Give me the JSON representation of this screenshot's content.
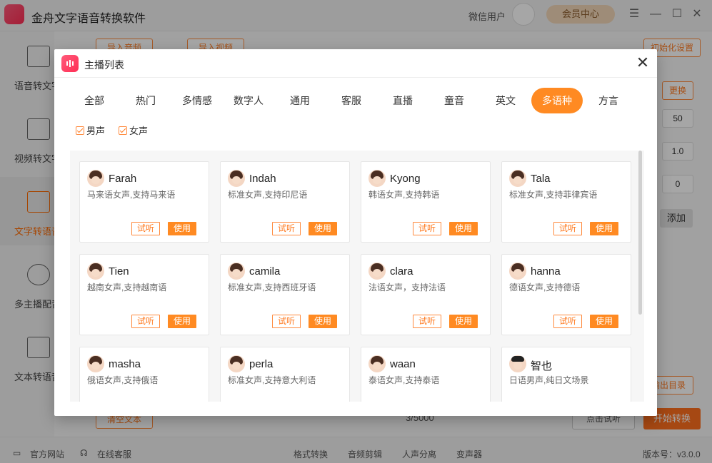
{
  "app": {
    "title": "金舟文字语音转换软件",
    "user_name": "微信用户",
    "vip_label": "会员中心"
  },
  "sidebar": {
    "items": [
      {
        "label": "语音转文字"
      },
      {
        "label": "视频转文字"
      },
      {
        "label": "文字转语音"
      },
      {
        "label": "多主播配音"
      },
      {
        "label": "文本转语音"
      }
    ]
  },
  "background": {
    "top_buttons": [
      "导入音频",
      "导入视频",
      "初始化设置"
    ],
    "change_label": "更换",
    "fields": [
      "50",
      "1.0",
      "0"
    ],
    "add_label": "添加",
    "clear_label": "清空文本",
    "char_count": "3/5000",
    "preview_label": "点击试听",
    "start_label": "开始转换",
    "output_label": "输出目录"
  },
  "status": {
    "website": "官方网站",
    "service": "在线客服",
    "tools": [
      "格式转换",
      "音频剪辑",
      "人声分离",
      "变声器"
    ],
    "version": "版本号：v3.0.0"
  },
  "modal": {
    "title": "主播列表",
    "tabs": [
      "全部",
      "热门",
      "多情感",
      "数字人",
      "通用",
      "客服",
      "直播",
      "童音",
      "英文",
      "多语种",
      "方言"
    ],
    "active_tab": "多语种",
    "filters": [
      "男声",
      "女声"
    ],
    "listen_label": "试听",
    "use_label": "使用",
    "voices": [
      {
        "name": "Farah",
        "desc": "马来语女声,支持马来语",
        "gender": "female"
      },
      {
        "name": "Indah",
        "desc": "标准女声,支持印尼语",
        "gender": "female"
      },
      {
        "name": "Kyong",
        "desc": "韩语女声,支持韩语",
        "gender": "female"
      },
      {
        "name": "Tala",
        "desc": "标准女声,支持菲律宾语",
        "gender": "female"
      },
      {
        "name": "Tien",
        "desc": "越南女声,支持越南语",
        "gender": "female"
      },
      {
        "name": "camila",
        "desc": "标准女声,支持西班牙语",
        "gender": "female"
      },
      {
        "name": "clara",
        "desc": "法语女声，支持法语",
        "gender": "female"
      },
      {
        "name": "hanna",
        "desc": "德语女声,支持德语",
        "gender": "female"
      },
      {
        "name": "masha",
        "desc": "俄语女声,支持俄语",
        "gender": "female"
      },
      {
        "name": "perla",
        "desc": "标准女声,支持意大利语",
        "gender": "female"
      },
      {
        "name": "waan",
        "desc": "泰语女声,支持泰语",
        "gender": "female"
      },
      {
        "name": "智也",
        "desc": "日语男声,纯日文场景",
        "gender": "male"
      }
    ]
  }
}
